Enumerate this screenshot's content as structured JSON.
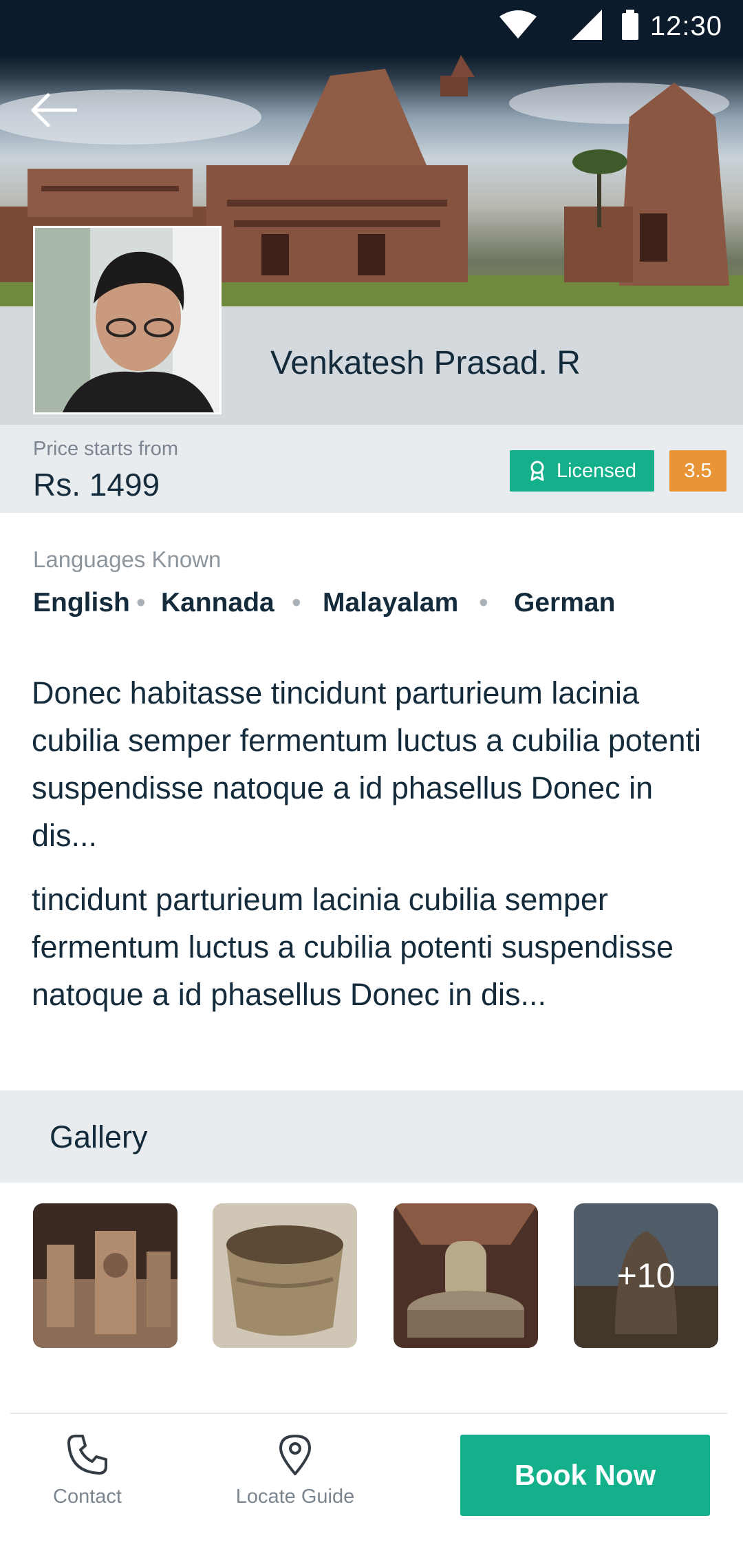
{
  "status_bar": {
    "time": "12:30"
  },
  "profile": {
    "name": "Venkatesh Prasad. R",
    "price_label": "Price starts from",
    "price": "Rs. 1499",
    "licensed_label": "Licensed",
    "rating": "3.5"
  },
  "languages": {
    "label": "Languages Known",
    "items": [
      "English",
      "Kannada",
      "Malayalam",
      "German"
    ]
  },
  "description": {
    "paragraph_1": "Donec habitasse tincidunt parturieum lacinia cubilia semper fermentum luctus a cubilia potenti suspendisse natoque a id phasellus Donec  in dis...",
    "paragraph_2": "tincidunt parturieum lacinia cubilia semper fermentum luctus a cubilia potenti suspendisse natoque a id phasellus Donec  in dis..."
  },
  "gallery": {
    "title": "Gallery",
    "more_count": "+10"
  },
  "bottom_nav": {
    "contact_label": "Contact",
    "locate_label": "Locate Guide",
    "book_label": "Book Now"
  },
  "colors": {
    "primary": "#14b08c",
    "rating": "#e89538",
    "text": "#142b3c"
  }
}
